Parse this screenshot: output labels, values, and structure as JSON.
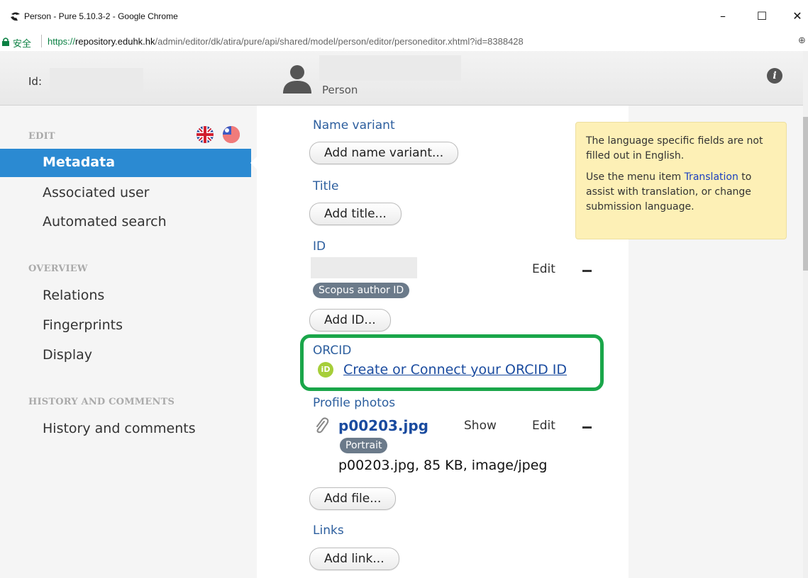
{
  "window": {
    "title": "Person - Pure 5.10.3-2 - Google Chrome",
    "minimize": "–",
    "maximize": "☐",
    "close": "✕"
  },
  "urlbar": {
    "secure_label": "安全",
    "url_scheme": "https://",
    "url_host": "repository.eduhk.hk",
    "url_path": "/admin/editor/dk/atira/pure/api/shared/model/person/editor/personeditor.xhtml?id=8388428",
    "zoom_icon": "⊕"
  },
  "header": {
    "id_label": "Id:",
    "type_label": "Person",
    "info_icon": "i"
  },
  "sidebar": {
    "edit_heading": "EDIT",
    "edit_items": [
      "Metadata",
      "Associated user",
      "Automated search"
    ],
    "overview_heading": "OVERVIEW",
    "overview_items": [
      "Relations",
      "Fingerprints",
      "Display"
    ],
    "history_heading": "HISTORY AND COMMENTS",
    "history_items": [
      "History and comments"
    ]
  },
  "main": {
    "name_variant_label": "Name variant",
    "add_name_variant": "Add name variant...",
    "title_label": "Title",
    "add_title": "Add title...",
    "id_label": "ID",
    "id_edit": "Edit",
    "id_tag": "Scopus author ID",
    "add_id": "Add ID...",
    "orcid_label": "ORCID",
    "orcid_icon_text": "iD",
    "orcid_link": "Create or Connect your ORCID ID",
    "photos_label": "Profile photos",
    "photo_file": "p00203.jpg",
    "photo_show": "Show",
    "photo_edit": "Edit",
    "photo_tag": "Portrait",
    "photo_meta": "p00203.jpg, 85 KB, image/jpeg",
    "add_file": "Add file...",
    "links_label": "Links",
    "add_link": "Add link..."
  },
  "notice": {
    "line1": "The language specific fields are not filled out in English.",
    "line2_pre": "Use the menu item ",
    "line2_link": "Translation",
    "line2_post": " to assist with translation, or change submission language."
  },
  "colors": {
    "accent": "#2b8ad2",
    "label_blue": "#2c5e9e",
    "highlight_green": "#1aa64a",
    "notice_bg": "#fdf0b6",
    "orcid_green": "#a6ce39"
  }
}
